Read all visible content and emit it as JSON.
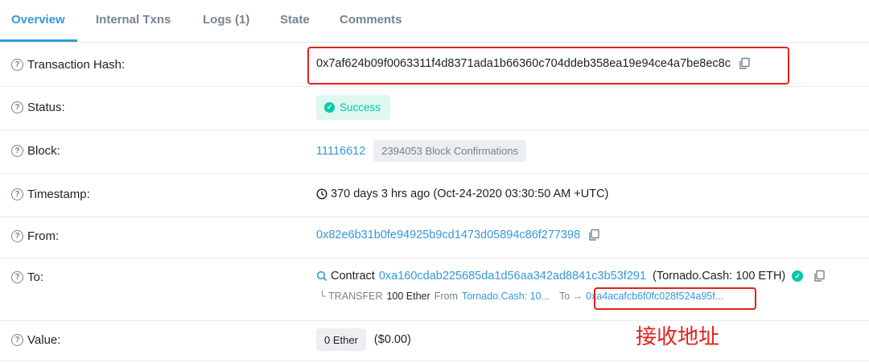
{
  "tabs": [
    {
      "label": "Overview",
      "active": true
    },
    {
      "label": "Internal Txns",
      "active": false
    },
    {
      "label": "Logs (1)",
      "active": false
    },
    {
      "label": "State",
      "active": false
    },
    {
      "label": "Comments",
      "active": false
    }
  ],
  "rows": {
    "hash": {
      "label": "Transaction Hash:",
      "value": "0x7af624b09f0063311f4d8371ada1b66360c704ddeb358ea19e94ce4a7be8ec8c"
    },
    "status": {
      "label": "Status:",
      "value": "Success"
    },
    "block": {
      "label": "Block:",
      "number": "11116612",
      "confirmations": "2394053 Block Confirmations"
    },
    "timestamp": {
      "label": "Timestamp:",
      "value": "370 days 3 hrs ago (Oct-24-2020 03:30:50 AM +UTC)"
    },
    "from": {
      "label": "From:",
      "value": "0x82e6b31b0fe94925b9cd1473d05894c86f277398"
    },
    "to": {
      "label": "To:",
      "contract_prefix": "Contract",
      "contract_address": "0xa160cdab225685da1d56aa342ad8841c3b53f291",
      "contract_name": "(Tornado.Cash: 100 ETH)",
      "transfer": {
        "prefix": "└ TRANSFER",
        "amount": "100 Ether",
        "from_label": "From",
        "from_value": "Tornado.Cash: 10...",
        "to_label": "To →",
        "to_value": "0xa4acafcb6f0fc028f524a95f..."
      }
    },
    "value": {
      "label": "Value:",
      "amount": "0 Ether",
      "usd": "($0.00)"
    }
  },
  "annotation": {
    "text": "接收地址"
  },
  "colors": {
    "link": "#3498db",
    "success": "#00c9a7",
    "highlight": "#e3221b"
  }
}
